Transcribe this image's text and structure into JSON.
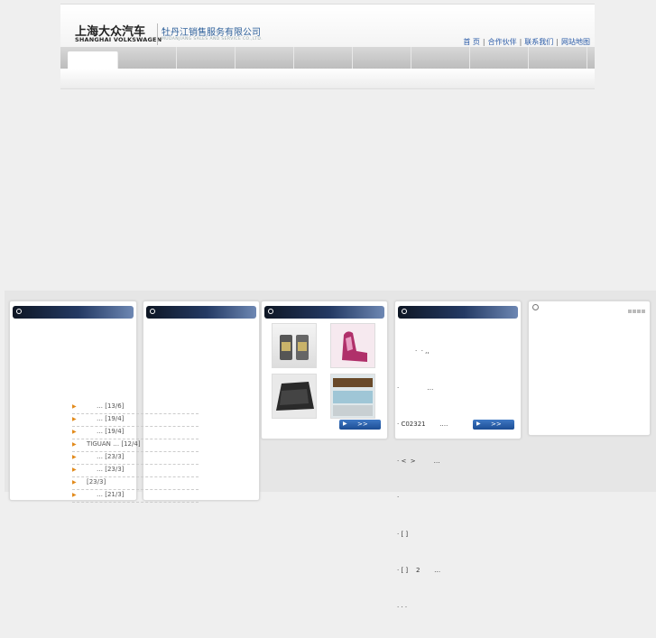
{
  "brand": {
    "logo_cn": "上海大众汽车",
    "logo_en": "SHANGHAI VOLKSWAGEN",
    "dealer_cn": "牡丹江销售服务有限公司",
    "dealer_en": "MUDANJIANG SALES AND SERVICE CO.,LTD."
  },
  "toplinks": [
    "首 页",
    "合作伙伴",
    "联系我们",
    "网站地图"
  ],
  "news_list": [
    {
      "text": "… [13/6]"
    },
    {
      "text": "… [19/4]"
    },
    {
      "text": "… [19/4]"
    },
    {
      "text": "TIGUAN   … [12/4]"
    },
    {
      "text": "… [23/3]"
    },
    {
      "text": "… [23/3]"
    },
    {
      "text": "[23/3]"
    },
    {
      "text": "… [21/3]"
    }
  ],
  "panel3": {
    "more_label": ">>"
  },
  "panel4": {
    "lines": [
      "         ·  · ,,",
      "·              …",
      "· C02321       ….",
      "· <  >         …",
      "·",
      "· [ ]",
      "· [ ]    2       …",
      "· · ·"
    ],
    "more_label": ">>"
  },
  "icons": [
    "title-dot-icon",
    "arrow-icon",
    "play-icon"
  ]
}
